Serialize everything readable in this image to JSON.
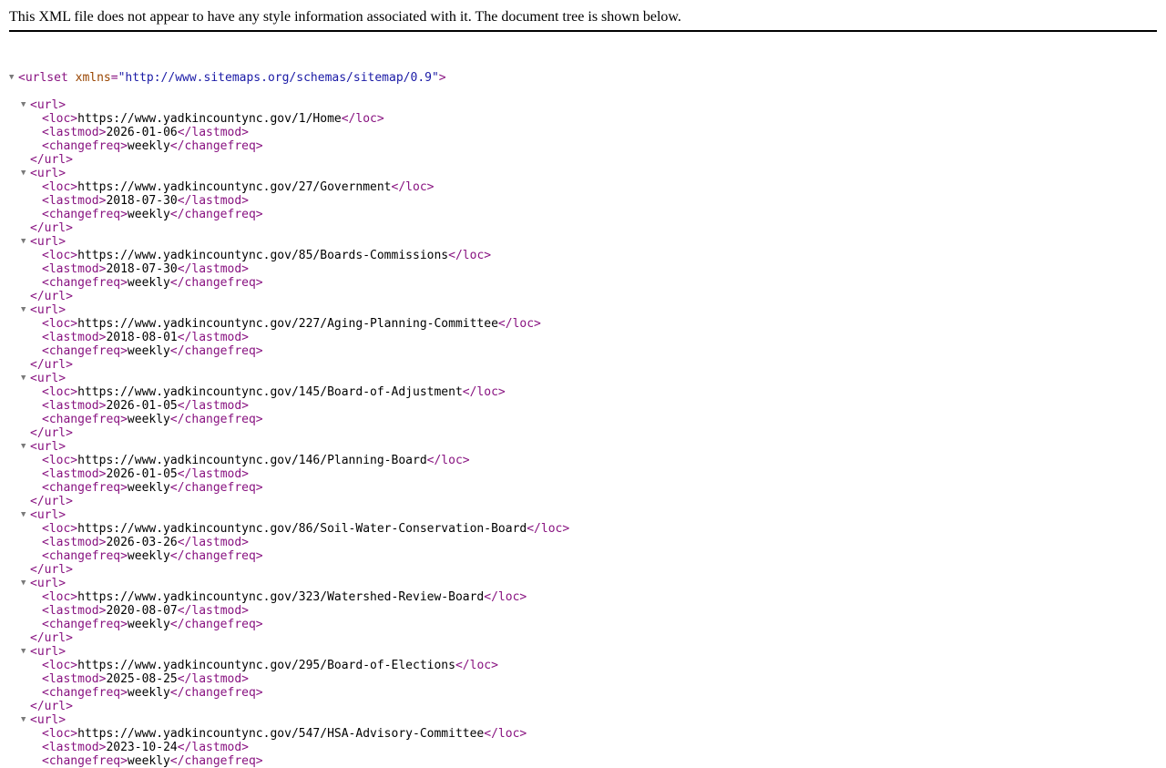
{
  "notice": "This XML file does not appear to have any style information associated with it. The document tree is shown below.",
  "tree": {
    "collapse_glyph": "▼",
    "urlset_open_prefix": "<urlset",
    "urlset_attr_name": "xmlns",
    "urlset_attr_eq": "=",
    "urlset_attr_value": "\"http://www.sitemaps.org/schemas/sitemap/0.9\"",
    "urlset_open_suffix": ">",
    "url_open": "<url>",
    "url_close": "</url>",
    "loc_open": "<loc>",
    "loc_close": "</loc>",
    "lastmod_open": "<lastmod>",
    "lastmod_close": "</lastmod>",
    "changefreq_open": "<changefreq>",
    "changefreq_close": "</changefreq>",
    "urls": [
      {
        "loc": "https://www.yadkincountync.gov/1/Home",
        "lastmod": "2026-01-06",
        "changefreq": "weekly"
      },
      {
        "loc": "https://www.yadkincountync.gov/27/Government",
        "lastmod": "2018-07-30",
        "changefreq": "weekly"
      },
      {
        "loc": "https://www.yadkincountync.gov/85/Boards-Commissions",
        "lastmod": "2018-07-30",
        "changefreq": "weekly"
      },
      {
        "loc": "https://www.yadkincountync.gov/227/Aging-Planning-Committee",
        "lastmod": "2018-08-01",
        "changefreq": "weekly"
      },
      {
        "loc": "https://www.yadkincountync.gov/145/Board-of-Adjustment",
        "lastmod": "2026-01-05",
        "changefreq": "weekly"
      },
      {
        "loc": "https://www.yadkincountync.gov/146/Planning-Board",
        "lastmod": "2026-01-05",
        "changefreq": "weekly"
      },
      {
        "loc": "https://www.yadkincountync.gov/86/Soil-Water-Conservation-Board",
        "lastmod": "2026-03-26",
        "changefreq": "weekly"
      },
      {
        "loc": "https://www.yadkincountync.gov/323/Watershed-Review-Board",
        "lastmod": "2020-08-07",
        "changefreq": "weekly"
      },
      {
        "loc": "https://www.yadkincountync.gov/295/Board-of-Elections",
        "lastmod": "2025-08-25",
        "changefreq": "weekly"
      },
      {
        "loc": "https://www.yadkincountync.gov/547/HSA-Advisory-Committee",
        "lastmod": "2023-10-24",
        "changefreq": "weekly"
      }
    ]
  }
}
